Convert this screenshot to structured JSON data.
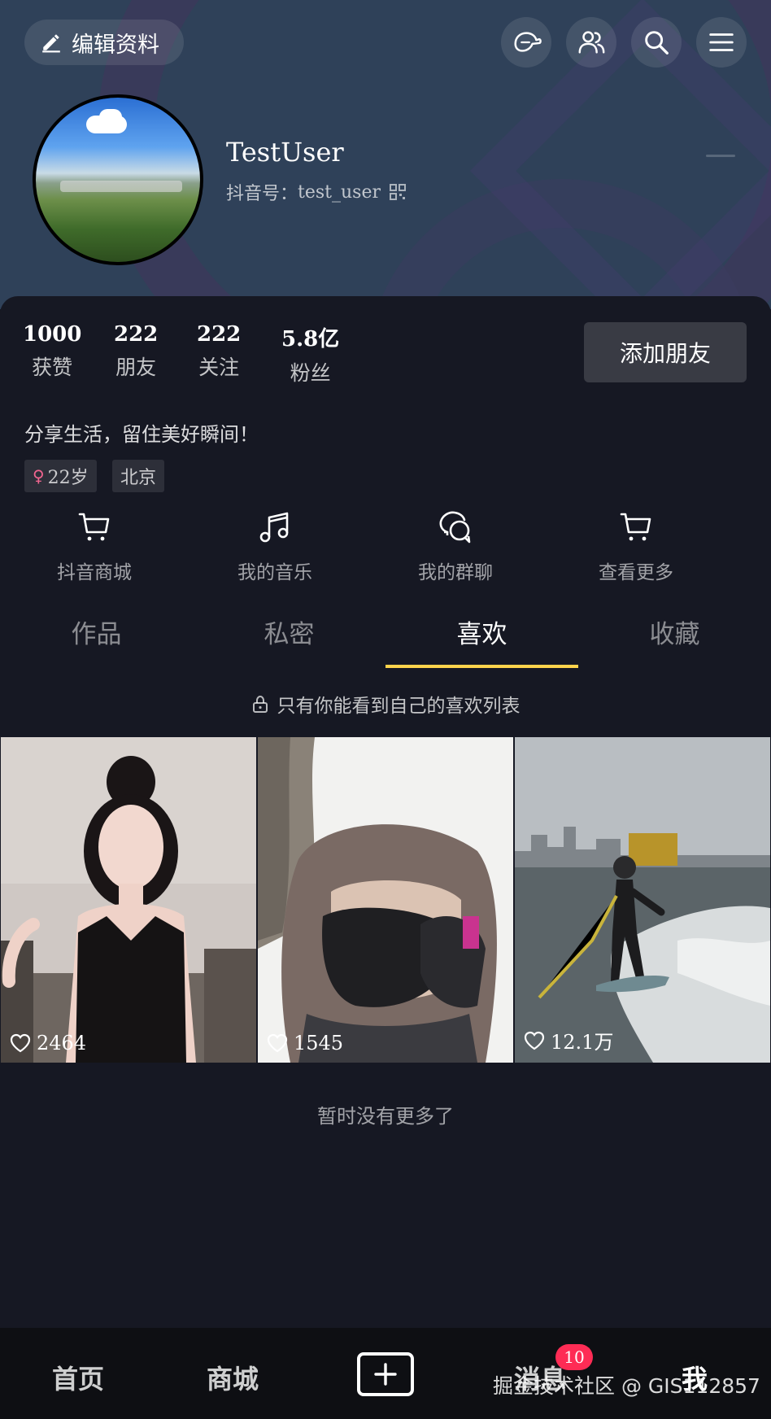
{
  "header": {
    "edit_label": "编辑资料",
    "username": "TestUser",
    "douyin_id_label": "抖音号：",
    "douyin_id_value": "test_user"
  },
  "stats": [
    {
      "num": "1000",
      "label": "获赞"
    },
    {
      "num": "222",
      "label": "朋友"
    },
    {
      "num": "222",
      "label": "关注"
    },
    {
      "num": "5.8亿",
      "label": "粉丝"
    }
  ],
  "add_friend_label": "添加朋友",
  "bio": "分享生活，留住美好瞬间！",
  "tags": {
    "age": "22岁",
    "age_icon": "♀",
    "city": "北京"
  },
  "shortcuts": [
    {
      "label": "抖音商城",
      "icon": "cart-icon"
    },
    {
      "label": "我的音乐",
      "icon": "music-icon"
    },
    {
      "label": "我的群聊",
      "icon": "group-chat-icon"
    },
    {
      "label": "查看更多",
      "icon": "cart-icon"
    }
  ],
  "tabs": [
    {
      "label": "作品"
    },
    {
      "label": "私密"
    },
    {
      "label": "喜欢",
      "active": true
    },
    {
      "label": "收藏"
    }
  ],
  "private_note": "只有你能看到自己的喜欢列表",
  "videos": [
    {
      "likes": "2464"
    },
    {
      "likes": "1545"
    },
    {
      "likes": "12.1万"
    }
  ],
  "no_more": "暂时没有更多了",
  "bottom_nav": {
    "home": "首页",
    "mall": "商城",
    "messages": "消息",
    "messages_badge": "10",
    "me": "我"
  },
  "watermark": "掘金技术社区 @ GIS112857",
  "colors": {
    "background": "#161823",
    "header": "#2f4159",
    "tab_indicator": "#fdd34c",
    "badge": "#fe2c55",
    "gender": "#f0658f"
  }
}
